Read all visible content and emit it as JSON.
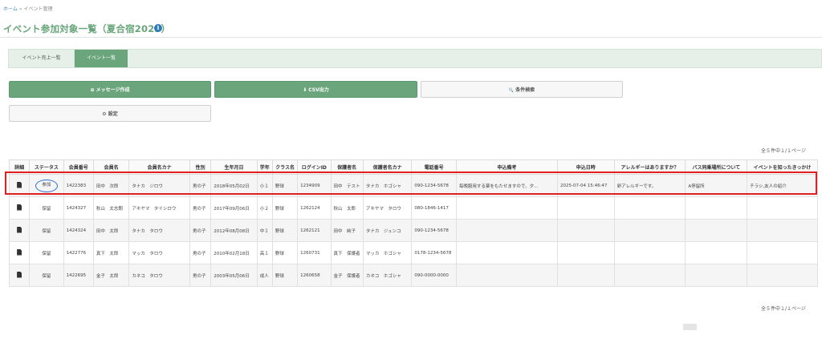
{
  "breadcrumb": {
    "home": "ホーム",
    "separator": "»",
    "current": "イベント管理"
  },
  "page": {
    "title": "イベント参加対象一覧（夏合宿2025）",
    "info_icon": "i"
  },
  "tabs": [
    {
      "label": "イベント売上一覧",
      "active": false
    },
    {
      "label": "イベント一覧",
      "active": true
    }
  ],
  "actions": {
    "message": {
      "icon": "plus-circle-icon",
      "glyph": "⊕",
      "label": "メッセージ作成"
    },
    "csv": {
      "icon": "download-icon",
      "glyph": "⬇",
      "label": "CSV出力"
    },
    "search": {
      "icon": "search-icon",
      "glyph": "🔍",
      "label": "条件検索"
    },
    "settings": {
      "icon": "gear-icon",
      "glyph": "⚙",
      "label": "設定"
    }
  },
  "counts": {
    "top": "全５件中１/１ページ",
    "bottom": "全５件中１/１ページ"
  },
  "colors": {
    "accent": "#6aa57c",
    "title": "#68a57a",
    "highlight": "#e02020",
    "circle": "#2f6fd0"
  },
  "table": {
    "headers": [
      "詳細",
      "ステータス",
      "会員番号",
      "会員名",
      "会員名カナ",
      "性別",
      "生年月日",
      "学年",
      "クラス名",
      "ログインID",
      "保護者名",
      "保護者名カナ",
      "電話番号",
      "申込備考",
      "申込日時",
      "アレルギーはありますか？",
      "バス同乗場所について",
      "イベントを知ったきっかけ"
    ],
    "rows": [
      {
        "status": "参加",
        "member_no": "1422383",
        "name": "田中　次郎",
        "kana": "タナカ　ジロウ",
        "gender": "男の子",
        "birth": "2018年05月02日",
        "grade": "小１",
        "class": "野球",
        "login": "1234909",
        "guardian": "田中　テスト",
        "guardian_kana": "タナカ　ホゴシャ",
        "phone": "090-1234-5678",
        "note": "毎晩服用する薬をもたせますので、夕...",
        "applied": "2025-07-04 15:46:47",
        "allergy": "卵アレルギーです。",
        "bus": "A停留所",
        "source": "チラシ,友人の紹介"
      },
      {
        "status": "保留",
        "member_no": "1424327",
        "name": "秋山　太志朗",
        "kana": "アキヤマ　タイシロウ",
        "gender": "男の子",
        "birth": "2017年09月06日",
        "grade": "小２",
        "class": "野球",
        "login": "1262124",
        "guardian": "秋山　太郎",
        "guardian_kana": "アキヤマ　タロウ",
        "phone": "080-1846-1417",
        "note": "",
        "applied": "",
        "allergy": "",
        "bus": "",
        "source": ""
      },
      {
        "status": "保留",
        "member_no": "1424324",
        "name": "田中　太郎",
        "kana": "タナカ　タロウ",
        "gender": "男の子",
        "birth": "2012年08月08日",
        "grade": "中１",
        "class": "野球",
        "login": "1262121",
        "guardian": "田中　純子",
        "guardian_kana": "タナカ　ジュンコ",
        "phone": "090-1234-5678",
        "note": "",
        "applied": "",
        "allergy": "",
        "bus": "",
        "source": ""
      },
      {
        "status": "保留",
        "member_no": "1422776",
        "name": "真下　太郎",
        "kana": "マッカ　タロウ",
        "gender": "男の子",
        "birth": "2010年02月18日",
        "grade": "高１",
        "class": "野球",
        "login": "1260731",
        "guardian": "真下　保護者",
        "guardian_kana": "マッカ　ホゴシャ",
        "phone": "0178-1234-5678",
        "note": "",
        "applied": "",
        "allergy": "",
        "bus": "",
        "source": ""
      },
      {
        "status": "保留",
        "member_no": "1422695",
        "name": "金子　太郎",
        "kana": "カネコ　タロウ",
        "gender": "男の子",
        "birth": "2003年05月06日",
        "grade": "成人",
        "class": "野球",
        "login": "1260658",
        "guardian": "金子　保護者",
        "guardian_kana": "カネコ　ホゴシャ",
        "phone": "090-0000-0000",
        "note": "",
        "applied": "",
        "allergy": "",
        "bus": "",
        "source": ""
      }
    ]
  }
}
